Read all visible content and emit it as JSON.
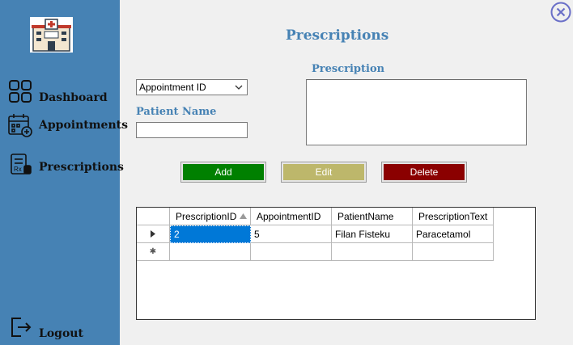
{
  "sidebar": {
    "items": [
      {
        "label": "Dashboard",
        "icon": "dashboard-icon"
      },
      {
        "label": "Appointments",
        "icon": "calendar-icon"
      },
      {
        "label": "Prescriptions",
        "icon": "prescription-icon"
      }
    ],
    "logout": {
      "label": "Logout",
      "icon": "logout-icon"
    },
    "logo": "hospital-icon",
    "bg_color": "#4682b4"
  },
  "header": {
    "title": "Prescriptions"
  },
  "form": {
    "appointment_select_value": "Appointment ID",
    "patient_name_label": "Patient Name",
    "patient_name_value": "",
    "prescription_label": "Prescription",
    "prescription_value": ""
  },
  "buttons": {
    "add": {
      "label": "Add",
      "color": "#008000"
    },
    "edit": {
      "label": "Edit",
      "color": "#bdb76b"
    },
    "delete": {
      "label": "Delete",
      "color": "#8b0000"
    }
  },
  "table": {
    "columns": [
      "PrescriptionID",
      "AppointmentID",
      "PatientName",
      "PrescriptionText"
    ],
    "sorted_column": "PrescriptionID",
    "rows": [
      {
        "PrescriptionID": "2",
        "AppointmentID": "5",
        "PatientName": "Filan Fisteku",
        "PrescriptionText": "Paracetamol"
      }
    ],
    "selection_color": "#0078d7"
  }
}
